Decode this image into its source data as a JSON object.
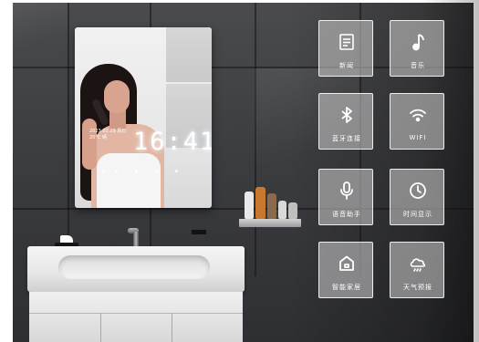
{
  "mirror": {
    "time": "16:41",
    "info_line1": "2023 01 29 周日",
    "info_line2": "20°C 晴"
  },
  "tiles": [
    {
      "label": "新闻",
      "icon": "news-icon"
    },
    {
      "label": "音乐",
      "icon": "music-note-icon"
    },
    {
      "label": "蓝牙连接",
      "icon": "bluetooth-icon"
    },
    {
      "label": "WIFI",
      "icon": "wifi-icon"
    },
    {
      "label": "语音助手",
      "icon": "microphone-icon"
    },
    {
      "label": "时间显示",
      "icon": "clock-icon"
    },
    {
      "label": "智能家居",
      "icon": "smart-home-icon"
    },
    {
      "label": "天气预报",
      "icon": "weather-cloud-icon"
    }
  ],
  "colors": {
    "wall": "#3c3d40",
    "tile_fill": "#d2d2d2",
    "tile_border": "#ffffff",
    "clock_glow": "#ffffff"
  }
}
